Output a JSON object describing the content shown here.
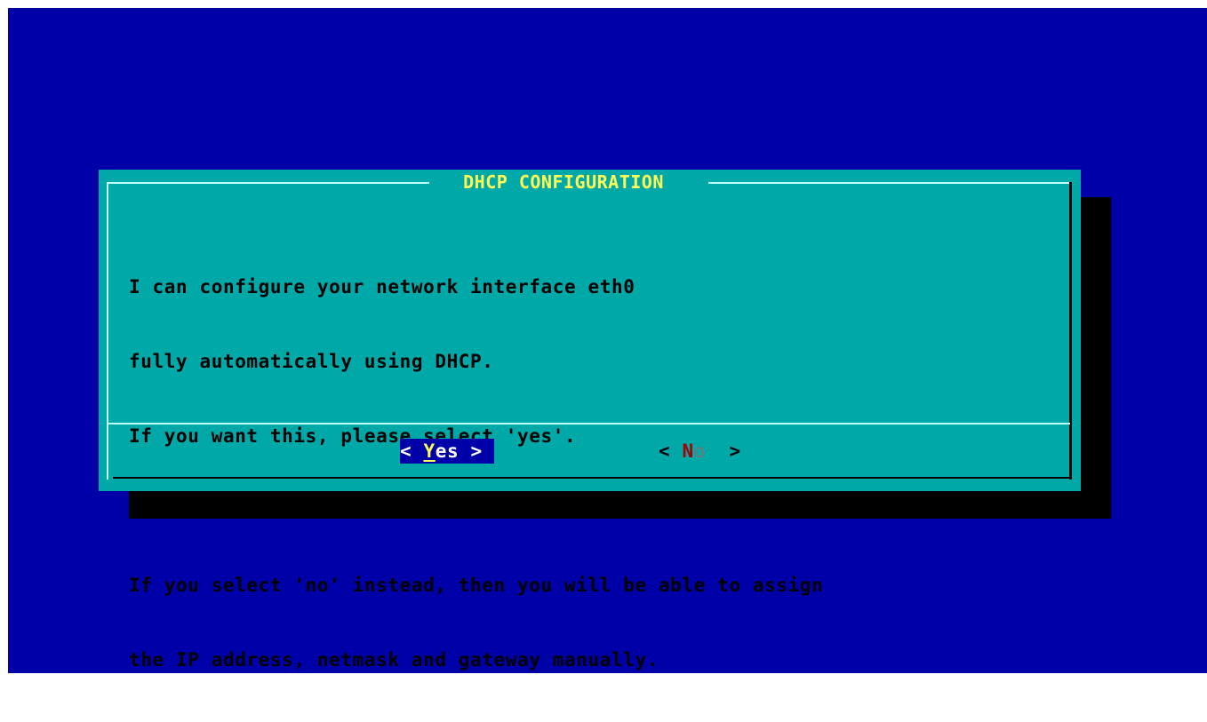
{
  "dialog": {
    "title": "DHCP CONFIGURATION",
    "message_lines": [
      "I can configure your network interface eth0",
      "fully automatically using DHCP.",
      "If you want this, please select 'yes'.",
      "",
      "If you select 'no' instead, then you will be able to assign",
      "the IP address, netmask and gateway manually."
    ]
  },
  "buttons": {
    "yes": {
      "open": "< ",
      "hotkey": "Y",
      "rest": "es",
      "close": " >"
    },
    "no": {
      "open": "< ",
      "hotkey": "N",
      "rest": "o",
      "close": "  >"
    }
  },
  "colors": {
    "background": "#0000a8",
    "dialog": "#00a8a8",
    "title": "#ffff54",
    "selected_button": "#0000a8",
    "hotkey_no": "#a80000"
  }
}
